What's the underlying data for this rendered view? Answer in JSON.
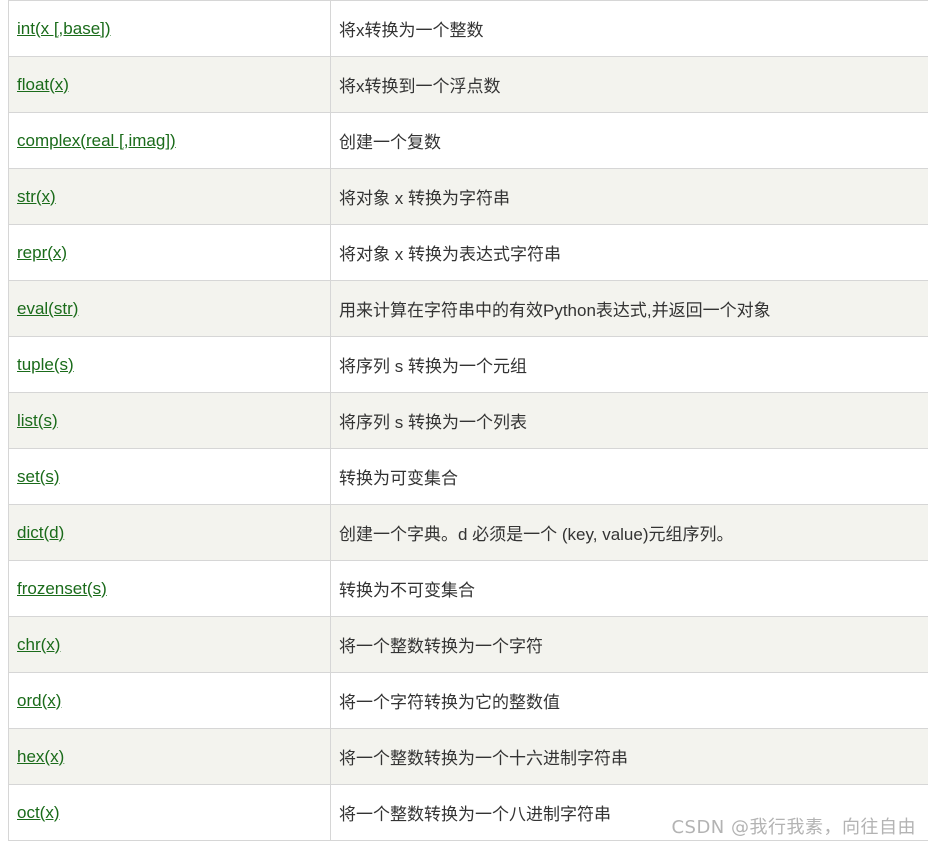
{
  "table": {
    "rows": [
      {
        "func": "int(x [,base])",
        "desc": "将x转换为一个整数"
      },
      {
        "func": "float(x)",
        "desc": "将x转换到一个浮点数"
      },
      {
        "func": "complex(real [,imag])",
        "desc": "创建一个复数"
      },
      {
        "func": "str(x)",
        "desc": "将对象 x 转换为字符串"
      },
      {
        "func": "repr(x)",
        "desc": "将对象 x 转换为表达式字符串"
      },
      {
        "func": "eval(str)",
        "desc": "用来计算在字符串中的有效Python表达式,并返回一个对象"
      },
      {
        "func": "tuple(s)",
        "desc": "将序列 s 转换为一个元组"
      },
      {
        "func": "list(s)",
        "desc": "将序列 s 转换为一个列表"
      },
      {
        "func": "set(s)",
        "desc": "转换为可变集合"
      },
      {
        "func": "dict(d)",
        "desc": "创建一个字典。d 必须是一个 (key, value)元组序列。"
      },
      {
        "func": "frozenset(s)",
        "desc": "转换为不可变集合"
      },
      {
        "func": "chr(x)",
        "desc": "将一个整数转换为一个字符"
      },
      {
        "func": "ord(x)",
        "desc": "将一个字符转换为它的整数值"
      },
      {
        "func": "hex(x)",
        "desc": "将一个整数转换为一个十六进制字符串"
      },
      {
        "func": "oct(x)",
        "desc": "将一个整数转换为一个八进制字符串"
      }
    ]
  },
  "watermark": "CSDN @我行我素，向往自由"
}
